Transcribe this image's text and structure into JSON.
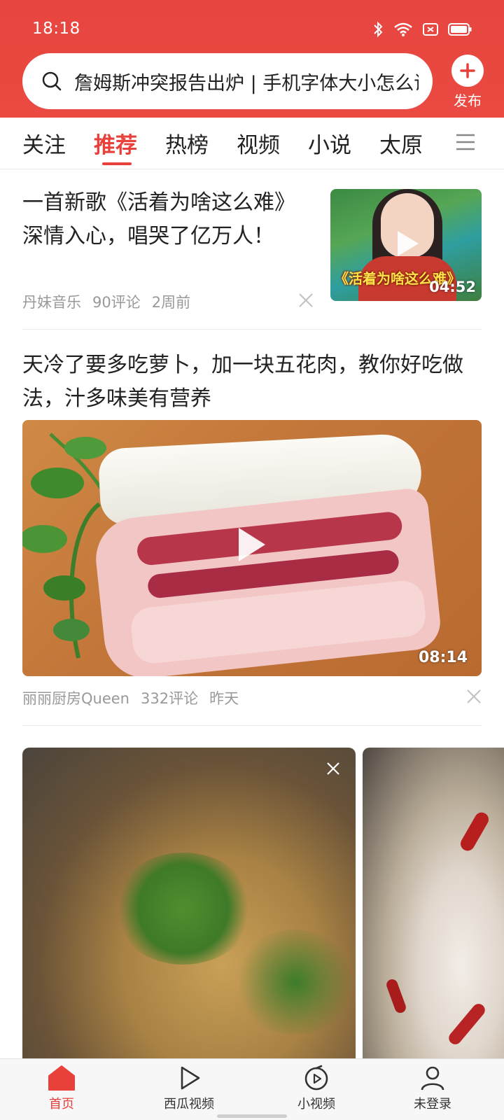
{
  "status_bar": {
    "time": "18:18",
    "icons": [
      "bluetooth-icon",
      "wifi-icon",
      "sim-icon",
      "battery-icon"
    ]
  },
  "search": {
    "text": "詹姆斯冲突报告出炉 | 手机字体大小怎么调"
  },
  "publish": {
    "label": "发布"
  },
  "tabs": [
    {
      "label": "关注",
      "active": false
    },
    {
      "label": "推荐",
      "active": true
    },
    {
      "label": "热榜",
      "active": false
    },
    {
      "label": "视频",
      "active": false
    },
    {
      "label": "小说",
      "active": false
    },
    {
      "label": "太原",
      "active": false
    }
  ],
  "feed": [
    {
      "title": "一首新歌《活着为啥这么难》深情入心，唱哭了亿万人！",
      "source": "丹妹音乐",
      "comments": "90评论",
      "time": "2周前",
      "thumb_caption": "《活着为啥这么难》",
      "duration": "04:52"
    },
    {
      "title": "天冷了要多吃萝卜，加一块五花肉，教你好吃做法，汁多味美有营养",
      "source": "丽丽厨房Queen",
      "comments": "332评论",
      "time": "昨天",
      "duration": "08:14"
    }
  ],
  "bottom_nav": [
    {
      "label": "首页",
      "icon": "home-icon",
      "active": true
    },
    {
      "label": "西瓜视频",
      "icon": "play-icon",
      "active": false
    },
    {
      "label": "小视频",
      "icon": "short-video-icon",
      "active": false
    },
    {
      "label": "未登录",
      "icon": "user-icon",
      "active": false
    }
  ],
  "colors": {
    "brand_red": "#e8403a",
    "meta_gray": "#999999"
  }
}
